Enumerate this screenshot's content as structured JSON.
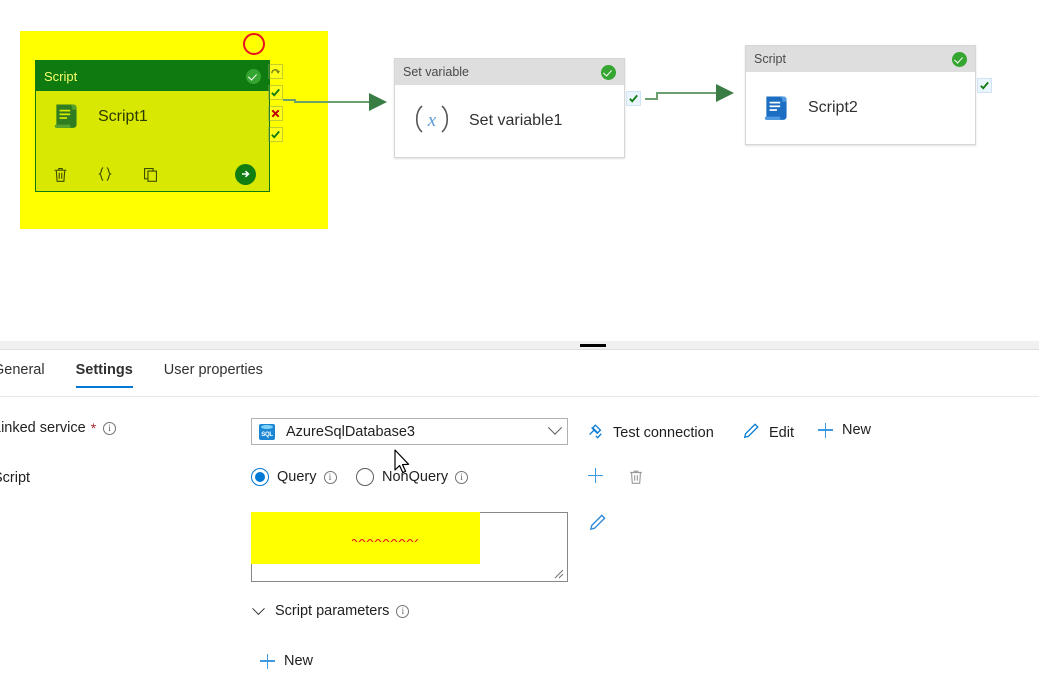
{
  "canvas": {
    "nodes": [
      {
        "id": "script1",
        "type_label": "Script",
        "name": "Script1",
        "icon": "script-scroll-icon",
        "status": "valid",
        "selected": true,
        "actions": [
          "delete-icon",
          "code-braces-icon",
          "clone-icon",
          "run-icon"
        ],
        "handles": [
          "retry-icon",
          "success-check-icon",
          "failure-x-icon",
          "completion-check-icon"
        ]
      },
      {
        "id": "setvariable1",
        "type_label": "Set variable",
        "name": "Set variable1",
        "icon": "set-variable-fx-icon",
        "status": "valid",
        "selected": false,
        "handles": [
          "success-check-icon"
        ]
      },
      {
        "id": "script2",
        "type_label": "Script",
        "name": "Script2",
        "icon": "script-scroll-icon",
        "status": "valid",
        "selected": false,
        "handles": [
          "success-check-icon"
        ]
      }
    ],
    "annotation": {
      "type": "circle",
      "color": "#e81123"
    },
    "highlight_color": "#ffff00",
    "connector_color": "#3a7d44"
  },
  "panel": {
    "tabs": [
      {
        "id": "general",
        "label": "General",
        "active": false
      },
      {
        "id": "settings",
        "label": "Settings",
        "active": true
      },
      {
        "id": "user-properties",
        "label": "User properties",
        "active": false
      }
    ],
    "accent_color": "#0078d4",
    "linked_service": {
      "label": "Linked service",
      "required": true,
      "value": "AzureSqlDatabase3",
      "icon": "sql-database-icon",
      "commands": [
        {
          "id": "test-connection",
          "label": "Test connection",
          "icon": "plug-check-icon"
        },
        {
          "id": "edit",
          "label": "Edit",
          "icon": "pencil-icon"
        },
        {
          "id": "new",
          "label": "New",
          "icon": "plus-icon"
        }
      ]
    },
    "script": {
      "label": "Script",
      "options": [
        {
          "id": "query",
          "label": "Query",
          "selected": true
        },
        {
          "id": "nonquery",
          "label": "NonQuery",
          "selected": false
        }
      ],
      "row_actions": [
        {
          "id": "add-script",
          "icon": "plus-icon"
        },
        {
          "id": "delete-script",
          "icon": "trash-icon"
        }
      ],
      "text": "select * from sampletb",
      "misspelled_word": "sampletb",
      "edit_icon": "pencil-icon",
      "highlight_color": "#ffff00"
    },
    "script_parameters": {
      "label": "Script parameters",
      "expanded": true,
      "new_label": "New",
      "new_icon": "plus-icon"
    }
  }
}
